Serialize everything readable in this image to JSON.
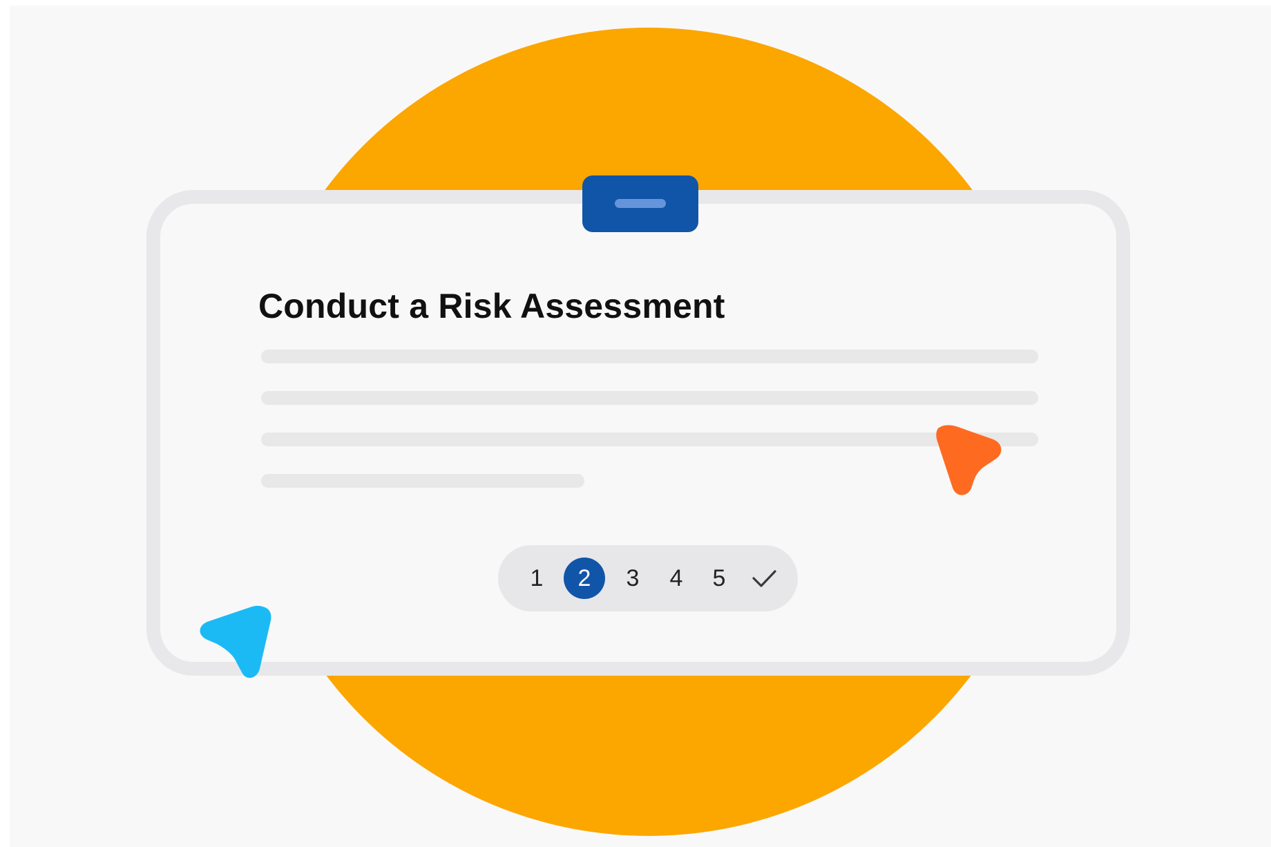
{
  "colors": {
    "sun": "#fca600",
    "brand_blue": "#1155a8",
    "pointer_orange": "#ff6a21",
    "pointer_cyan": "#1bbaf5"
  },
  "card": {
    "title": "Conduct a Risk Assessment",
    "clip_icon": "clip-tab-icon"
  },
  "stepper": {
    "steps": [
      "1",
      "2",
      "3",
      "4",
      "5"
    ],
    "active_step": 2,
    "done_icon": "checkmark-icon"
  },
  "decorations": {
    "pointer_right": "cursor-arrow-icon",
    "pointer_left": "cursor-arrow-icon"
  }
}
